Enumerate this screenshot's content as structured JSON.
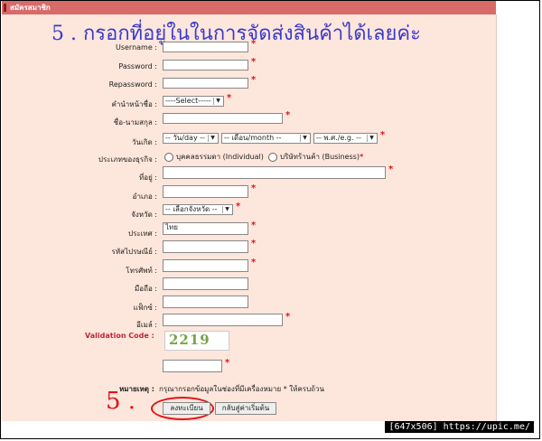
{
  "panel": {
    "title": "สมัครสมาชิก"
  },
  "headline": "5 . กรอกที่อยู่ในในการจัดส่งสินค้าได้เลยค่ะ",
  "fields": {
    "username": "Username :",
    "password": "Password :",
    "repassword": "Repassword :",
    "title": "คำนำหน้าชื่อ :",
    "fullname": "ชื่อ-นามสกุล :",
    "birthday": "วันเกิด :",
    "business_type": "ประเภทของธุรกิจ :",
    "address": "ที่อยู่ :",
    "district": "อำเภอ :",
    "province": "จังหวัด :",
    "country": "ประเทศ :",
    "postcode": "รหัสไปรษณีย์ :",
    "phone": "โทรศัพท์ :",
    "mobile": "มือถือ :",
    "fax": "แฟ็กซ์ :",
    "email": "อีเมล์ :"
  },
  "values": {
    "country": "ไทย"
  },
  "selects": {
    "title": "----Select-----",
    "day": "-- วัน/day --",
    "month": "-- เดือน/month --",
    "year": "-- พ.ศ./e.g. --",
    "province": "-- เลือกจังหวัด --"
  },
  "radios": {
    "individual": "บุคคลธรรมดา (Individual)",
    "business": "บริษัทร้านค้า (Business)"
  },
  "validation_label": "Validation Code :",
  "captcha": "2219",
  "note": {
    "label": "หมายเหตุ :",
    "text": "กรุณากรอกข้อมูลในช่องที่มีเครื่องหมาย * ให้ครบถ้วน"
  },
  "step_marker": "5 .",
  "buttons": {
    "submit": "ลงทะเบียน",
    "reset": "กลับสู่ค่าเริ่มต้น"
  },
  "watermark": "[647x506] https://upic.me/",
  "colors": {
    "panel_bg": "#fde6db",
    "header": "#d96a6a",
    "required": "#e0151a",
    "headline": "#3a3acd"
  }
}
